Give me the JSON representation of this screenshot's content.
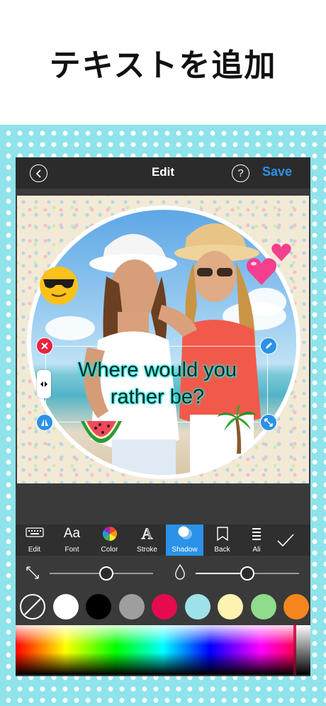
{
  "banner": {
    "title": "テキストを追加"
  },
  "navbar": {
    "title": "Edit",
    "save_label": "Save",
    "help_label": "?"
  },
  "canvas": {
    "overlay_text_line1": "Where would you",
    "overlay_text_line2": "rather be?",
    "text_shadow_color": "#2fe3d6"
  },
  "toolbar": {
    "tools": [
      {
        "label": "Edit",
        "icon": "keyboard-icon"
      },
      {
        "label": "Font",
        "icon": "font-icon",
        "glyph": "Aa"
      },
      {
        "label": "Color",
        "icon": "color-wheel-icon"
      },
      {
        "label": "Stroke",
        "icon": "stroke-icon",
        "glyph": "A"
      },
      {
        "label": "Shadow",
        "icon": "shadow-icon"
      },
      {
        "label": "Back",
        "icon": "back-layer-icon"
      },
      {
        "label": "Ali",
        "icon": "align-icon"
      }
    ],
    "active_tool": "Shadow",
    "accent_color": "#2a92e8"
  },
  "sliders": {
    "shadow_distance": 0.55,
    "shadow_opacity": 0.5
  },
  "swatches": [
    "none",
    "#ffffff",
    "#000000",
    "#9e9e9e",
    "#e60a4e",
    "#9fe3ea",
    "#fdf3b0",
    "#8fdc8c",
    "#f5861f"
  ]
}
